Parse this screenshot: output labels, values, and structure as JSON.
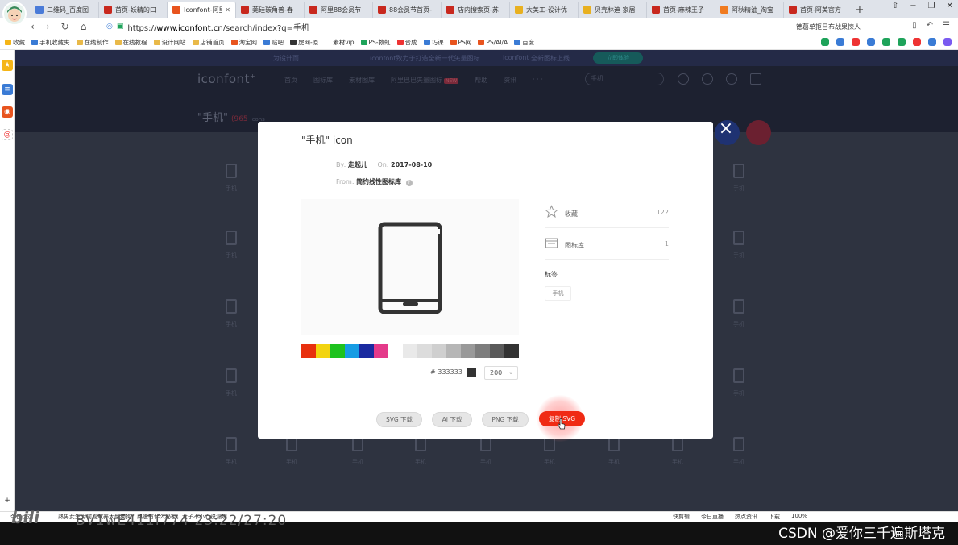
{
  "browser": {
    "tabs": [
      {
        "label": "二维码_百度图",
        "color": "#4a7bd8",
        "active": false
      },
      {
        "label": "首页-妖精的口",
        "color": "#c8281e",
        "active": false
      },
      {
        "label": "Iconfont-阿里",
        "color": "#e8541e",
        "active": true
      },
      {
        "label": "莞硅碳角普-春",
        "color": "#c8281e",
        "active": false
      },
      {
        "label": "阿里88会员节",
        "color": "#c8281e",
        "active": false
      },
      {
        "label": "88会员节首页-",
        "color": "#c8281e",
        "active": false
      },
      {
        "label": "店内搜索页-苏",
        "color": "#c8281e",
        "active": false
      },
      {
        "label": "大美工-设计优",
        "color": "#e8b020",
        "active": false
      },
      {
        "label": "贝壳林迪 家居",
        "color": "#e8b020",
        "active": false
      },
      {
        "label": "首页-麻辣王子",
        "color": "#c8281e",
        "active": false
      },
      {
        "label": "阿秋精油_淘宝",
        "color": "#f07b20",
        "active": false
      },
      {
        "label": "首页-阿美官方",
        "color": "#c8281e",
        "active": false
      }
    ],
    "url_scheme": "https://",
    "url_host": "www.iconfont.cn",
    "url_path": "/search/index?q=手机",
    "search_text": "德葛单拒吕布战果悚人",
    "bookmarks": [
      "收藏",
      "手机收藏夹",
      "在线制作",
      "在线教程",
      "设计网站",
      "店铺首页",
      "淘宝网",
      "贴吧",
      "虎网-原",
      "素材vip",
      "PS-教虹",
      "合成",
      "巧课",
      "PS网",
      "PS/AI/A",
      "百度"
    ]
  },
  "page": {
    "promo": [
      "为设计而",
      "iconfont致力于打造全新一代矢量图标",
      "iconfont",
      "全新图标上线",
      "立即体验"
    ],
    "logo": "iconfont",
    "logo_sup": "+",
    "nav": [
      "首页",
      "图标库",
      "素材图库",
      "阿里巴巴矢量图标",
      "帮助",
      "资讯"
    ],
    "nav_new_badge": "NEW",
    "nav_more": "· · ·",
    "search_placeholder": "手机",
    "search_title": "\"手机\"",
    "result_count": "(965",
    "result_icons": "icons",
    "bg_icon_label": "手机"
  },
  "modal": {
    "title": "\"手机\" icon",
    "by_label": "By:",
    "author": "走起儿",
    "on_label": "On:",
    "date": "2017-08-10",
    "from_label": "From:",
    "library": "简约线性图标库",
    "help_glyph": "?",
    "stats": [
      {
        "label": "收藏",
        "value": "122"
      },
      {
        "label": "图标库",
        "value": "1"
      }
    ],
    "tags_title": "标签",
    "tag": "手机",
    "color_value": "# 333333",
    "size_value": "200",
    "size_caret": "⌄",
    "swatch_colors": [
      "#e8300e",
      "#f2d410",
      "#1ec21e",
      "#169ce4",
      "#1a2aa0",
      "#e43a8a",
      "",
      "#e9e9e9",
      "#dcdcdc",
      "#cfcfcf",
      "#b6b6b6",
      "#999999",
      "#7d7d7d",
      "#5a5a5a",
      "#333333"
    ],
    "buttons": {
      "svg_download": "SVG 下载",
      "ai_download": "AI 下载",
      "png_download": "PNG 下载",
      "copy_svg": "复制 SVG"
    },
    "close_glyph": "×"
  },
  "statusbar": {
    "today": "今日优选",
    "news": "熟男女生为何喜欢养大型狗狗？熟遭有什么秘密，女子不小心说漏嘴",
    "right_items": [
      "快剪辑",
      "今日直播",
      "热点资讯",
      "下载",
      "100%"
    ]
  },
  "overlay": {
    "watermark": "BV1wE411f774 23:22/27:20",
    "bili": "bili",
    "csdn": "CSDN @爱你三千遍斯塔克"
  }
}
